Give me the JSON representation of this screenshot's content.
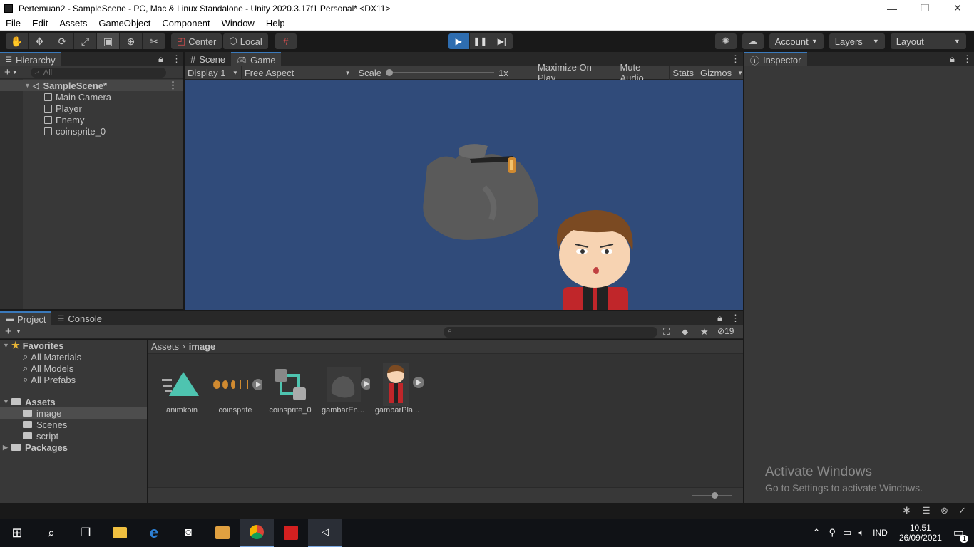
{
  "window": {
    "title": "Pertemuan2 - SampleScene - PC, Mac & Linux Standalone - Unity 2020.3.17f1 Personal* <DX11>",
    "minimize": "—",
    "restore": "❐",
    "close": "✕"
  },
  "menu": [
    "File",
    "Edit",
    "Assets",
    "GameObject",
    "Component",
    "Window",
    "Help"
  ],
  "toolbar": {
    "pivot": "Center",
    "space": "Local",
    "account": "Account",
    "layers": "Layers",
    "layout": "Layout"
  },
  "hierarchy": {
    "tab": "Hierarchy",
    "search_placeholder": "All",
    "scene": "SampleScene*",
    "items": [
      "Main Camera",
      "Player",
      "Enemy",
      "coinsprite_0"
    ]
  },
  "center": {
    "tabs": [
      "Scene",
      "Game"
    ],
    "display": "Display 1",
    "aspect": "Free Aspect",
    "scale_label": "Scale",
    "scale_value": "1x",
    "maximize": "Maximize On Play",
    "mute": "Mute Audio",
    "stats": "Stats",
    "gizmos": "Gizmos",
    "background_color": "#304b7a"
  },
  "inspector": {
    "tab": "Inspector"
  },
  "project": {
    "tabs": [
      "Project",
      "Console"
    ],
    "hidden_count": "19",
    "favorites_label": "Favorites",
    "favorites": [
      "All Materials",
      "All Models",
      "All Prefabs"
    ],
    "assets_label": "Assets",
    "folders": [
      "image",
      "Scenes",
      "script"
    ],
    "packages_label": "Packages",
    "breadcrumb": [
      "Assets",
      "image"
    ],
    "assets": [
      "animkoin",
      "coinsprite",
      "coinsprite_0",
      "gambarEn...",
      "gambarPla..."
    ]
  },
  "watermark": {
    "line1": "Activate Windows",
    "line2": "Go to Settings to activate Windows."
  },
  "taskbar": {
    "lang": "IND",
    "time": "10.51",
    "date": "26/09/2021",
    "notifications": "1"
  }
}
